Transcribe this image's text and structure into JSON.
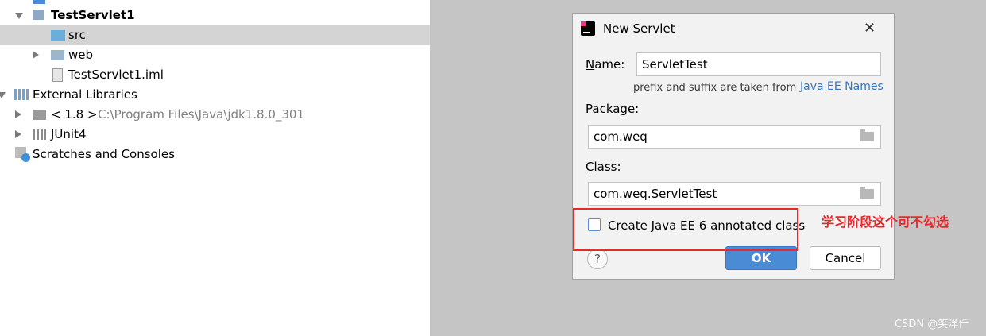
{
  "tree": {
    "items": [
      {
        "label": "TestServlet1",
        "bold": true,
        "expanded": true
      },
      {
        "label": "src",
        "selected": true
      },
      {
        "label": "web",
        "collapsed": true
      },
      {
        "label": "TestServlet1.iml"
      },
      {
        "label": "External Libraries",
        "expanded": true
      },
      {
        "label": "< 1.8 >",
        "extra": "C:\\Program Files\\Java\\jdk1.8.0_301",
        "collapsed": true
      },
      {
        "label": "JUnit4",
        "collapsed": true
      },
      {
        "label": "Scratches and Consoles"
      }
    ]
  },
  "dialog": {
    "title": "New Servlet",
    "name_label_mnemonic": "N",
    "name_label_rest": "ame:",
    "name_value": "ServletTest",
    "hint_text": "prefix and suffix are taken from",
    "hint_link": "Java EE Names",
    "package_label_mnemonic": "P",
    "package_label_rest": "ackage:",
    "package_value": "com.weq",
    "class_label_mnemonic": "C",
    "class_label_rest": "lass:",
    "class_value": "com.weq.ServletTest",
    "checkbox_label": "Create Java EE 6 annotated class",
    "checkbox_checked": false,
    "help": "?",
    "ok_label": "OK",
    "cancel_label": "Cancel"
  },
  "annotation": "学习阶段这个可不勾选",
  "watermark": "CSDN @笑洋仟",
  "colors": {
    "accent": "#4a8bd6",
    "link": "#2f76c6",
    "annotation": "#e8282d",
    "selection": "#d4d4d4"
  }
}
